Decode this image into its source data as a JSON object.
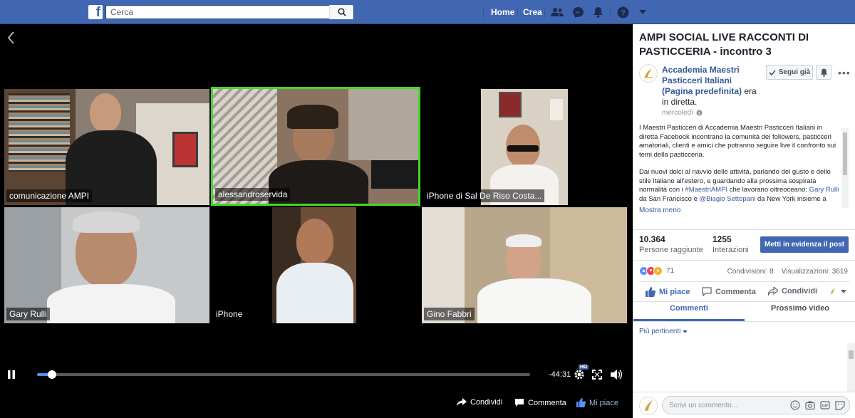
{
  "topbar": {
    "logo": "f",
    "search_placeholder": "Cerca",
    "home_label": "Home",
    "create_label": "Crea",
    "brand_color": "#4267b2",
    "icons": [
      "search-icon",
      "friend-requests-icon",
      "messenger-icon",
      "notifications-icon",
      "help-icon",
      "dropdown-icon"
    ]
  },
  "video": {
    "tiles": [
      {
        "name": "comunicazione AMPI"
      },
      {
        "name": "alessandroservida"
      },
      {
        "name": "iPhone di Sal De Riso Costa..."
      },
      {
        "name": "Gary Rulli"
      },
      {
        "name": "iPhone"
      },
      {
        "name": "Gino Fabbri"
      }
    ],
    "active_speaker_color": "#44d62c",
    "progress": 0.03,
    "time_left": "-44:31",
    "hd_badge": "HD",
    "actions": {
      "share": "Condividi",
      "comment": "Commenta",
      "like": "Mi piace"
    }
  },
  "panel": {
    "title": "AMPI SOCIAL LIVE RACCONTI DI PASTICCERIA - incontro 3",
    "page_name": "Accademia Maestri Pasticceri Italiani (Pagina predefinita)",
    "status_text": " era in diretta.",
    "date": "mercoledì",
    "follow_label": "Segui già",
    "description_p1": "I Maestri Pasticceri di Accademia Maestri Pasticceri Italiani in diretta Facebook incontrano la comunità dei followers, pasticceri amatoriali, clienti e amici che potranno seguire live il confronto sui temi della pasticceria.",
    "description_p2_a": "Dai nuovi dolci al riavvio delle attività, parlando del gusto e dello stile italiano all'estero, e guardando alla prossima sospirata normalità con i ",
    "description_hashtag": "#MaestriAMPI",
    "description_p2_b": " che lavorano oltreoceano: ",
    "description_name1": "Gary Rulli",
    "description_p2_c": " da San Francisco e ",
    "description_name2": "@Biagio Settepani",
    "description_p2_d": " da New York insieme a",
    "more_label": "Mostra meno",
    "stats": {
      "people_reached": "10.364",
      "people_reached_label": "Persone raggiunte",
      "interactions": "1255",
      "interactions_label": "Interazioni"
    },
    "boost_label": "Metti in evidenza il post",
    "reactions_count": "71",
    "shares": "Condivisioni: 8",
    "views": "Visualizzazioni: 3619",
    "like_label": "Mi piace",
    "comment_label": "Commenta",
    "share_label": "Condividi",
    "tab_comments": "Commenti",
    "tab_next": "Prossimo video",
    "sort_label": "Più pertinenti",
    "comment_placeholder": "Scrivi un commento..."
  }
}
